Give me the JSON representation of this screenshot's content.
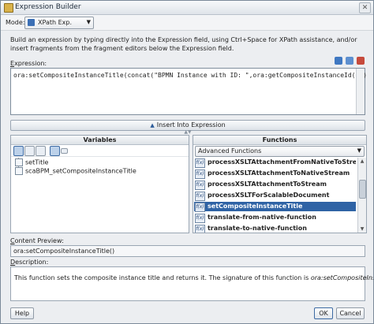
{
  "window": {
    "title": "Expression Builder"
  },
  "mode": {
    "label": "Mode:",
    "value": "XPath Exp."
  },
  "instructions": "Build an expression by typing directly into the Expression field, using Ctrl+Space for XPath assistance, and/or insert fragments from the fragment editors below the Expression field.",
  "expression": {
    "label_mnemonic": "E",
    "label_rest": "xpression:",
    "value": "ora:setCompositeInstanceTitle(concat(\"BPMN Instance with ID: \",ora:getCompositeInstanceId()))"
  },
  "insert_button": {
    "label": "Insert Into Expression"
  },
  "variables": {
    "header": "Variables",
    "tree": [
      {
        "label": "setTitle"
      },
      {
        "label": "scaBPM_setCompositeInstanceTitle"
      }
    ]
  },
  "functions": {
    "header": "Functions",
    "category": "Advanced Functions",
    "items": [
      {
        "label": "processXSLTAttachmentFromNativeToStream"
      },
      {
        "label": "processXSLTAttachmentToNativeStream"
      },
      {
        "label": "processXSLTAttachmentToStream"
      },
      {
        "label": "processXSLTForScalableDocument"
      },
      {
        "label": "setCompositeInstanceTitle",
        "selected": true
      },
      {
        "label": "translate-from-native-function"
      },
      {
        "label": "translate-to-native-function"
      }
    ],
    "fx_glyph": "f(x)"
  },
  "content_preview": {
    "label_mnemonic": "C",
    "label_rest": "ontent Preview:",
    "value": "ora:setCompositeInstanceTitle()"
  },
  "description": {
    "label_mnemonic": "D",
    "label_rest": "escription:",
    "text": "This function sets the composite instance title and returns it. The signature of this function is ",
    "signature": "ora:setCompositeInstanceTitle()",
    "end": "."
  },
  "buttons": {
    "help": "Help",
    "ok": "OK",
    "cancel": "Cancel"
  },
  "colors": {
    "selection": "#2f63a5",
    "frame": "#7b8a99",
    "panel_bg": "#eceef1"
  }
}
